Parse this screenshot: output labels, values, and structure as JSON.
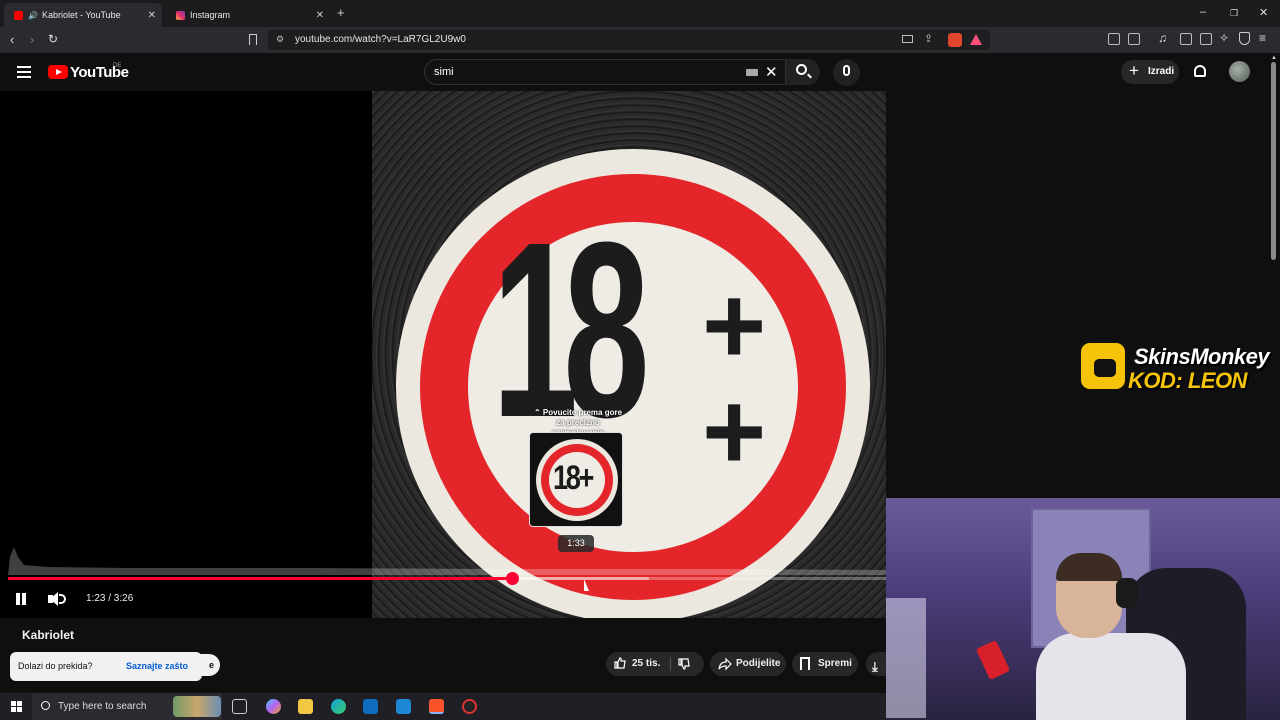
{
  "browser": {
    "tabs": [
      {
        "title": "Kabriolet - YouTube",
        "active": true,
        "favicon_color": "#ff0000"
      },
      {
        "title": "Instagram",
        "active": false,
        "favicon_color": "#e1306c"
      }
    ],
    "url": "youtube.com/watch?v=LaR7GL2U9w0"
  },
  "youtube": {
    "logo_text": "YouTube",
    "country_code": "DE",
    "search": {
      "value": "simi"
    },
    "create_label": "Izradi"
  },
  "player": {
    "video_art": {
      "age_text": "18",
      "plus": "+"
    },
    "scrub_hint": "⌃ Povucite prema gore za precizno premotavanje",
    "preview_time": "1:33",
    "preview_art_text": "18+",
    "current_time": "1:23",
    "duration": "3:26",
    "time_display": "1:23 / 3:26",
    "progress_fraction": 0.574,
    "buffer_fraction": 0.73,
    "accent_color": "#ff0033"
  },
  "video": {
    "title": "Kabriolet",
    "like_count": "25 tis.",
    "share_label": "Podijelite",
    "save_label": "Spremi"
  },
  "toast": {
    "text": "Dolazi do prekida?",
    "link": "Saznajte zašto",
    "subscribe_peek": "e"
  },
  "promo": {
    "line1": "SkinsMonkey",
    "line2": "KOD: LEON"
  },
  "taskbar": {
    "search_placeholder": "Type here to search"
  }
}
